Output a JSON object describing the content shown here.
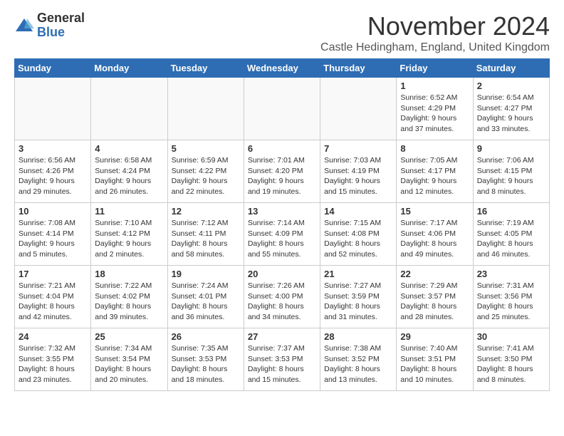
{
  "logo": {
    "general": "General",
    "blue": "Blue"
  },
  "title": "November 2024",
  "location": "Castle Hedingham, England, United Kingdom",
  "headers": [
    "Sunday",
    "Monday",
    "Tuesday",
    "Wednesday",
    "Thursday",
    "Friday",
    "Saturday"
  ],
  "weeks": [
    [
      {
        "day": "",
        "info": ""
      },
      {
        "day": "",
        "info": ""
      },
      {
        "day": "",
        "info": ""
      },
      {
        "day": "",
        "info": ""
      },
      {
        "day": "",
        "info": ""
      },
      {
        "day": "1",
        "info": "Sunrise: 6:52 AM\nSunset: 4:29 PM\nDaylight: 9 hours\nand 37 minutes."
      },
      {
        "day": "2",
        "info": "Sunrise: 6:54 AM\nSunset: 4:27 PM\nDaylight: 9 hours\nand 33 minutes."
      }
    ],
    [
      {
        "day": "3",
        "info": "Sunrise: 6:56 AM\nSunset: 4:26 PM\nDaylight: 9 hours\nand 29 minutes."
      },
      {
        "day": "4",
        "info": "Sunrise: 6:58 AM\nSunset: 4:24 PM\nDaylight: 9 hours\nand 26 minutes."
      },
      {
        "day": "5",
        "info": "Sunrise: 6:59 AM\nSunset: 4:22 PM\nDaylight: 9 hours\nand 22 minutes."
      },
      {
        "day": "6",
        "info": "Sunrise: 7:01 AM\nSunset: 4:20 PM\nDaylight: 9 hours\nand 19 minutes."
      },
      {
        "day": "7",
        "info": "Sunrise: 7:03 AM\nSunset: 4:19 PM\nDaylight: 9 hours\nand 15 minutes."
      },
      {
        "day": "8",
        "info": "Sunrise: 7:05 AM\nSunset: 4:17 PM\nDaylight: 9 hours\nand 12 minutes."
      },
      {
        "day": "9",
        "info": "Sunrise: 7:06 AM\nSunset: 4:15 PM\nDaylight: 9 hours\nand 8 minutes."
      }
    ],
    [
      {
        "day": "10",
        "info": "Sunrise: 7:08 AM\nSunset: 4:14 PM\nDaylight: 9 hours\nand 5 minutes."
      },
      {
        "day": "11",
        "info": "Sunrise: 7:10 AM\nSunset: 4:12 PM\nDaylight: 9 hours\nand 2 minutes."
      },
      {
        "day": "12",
        "info": "Sunrise: 7:12 AM\nSunset: 4:11 PM\nDaylight: 8 hours\nand 58 minutes."
      },
      {
        "day": "13",
        "info": "Sunrise: 7:14 AM\nSunset: 4:09 PM\nDaylight: 8 hours\nand 55 minutes."
      },
      {
        "day": "14",
        "info": "Sunrise: 7:15 AM\nSunset: 4:08 PM\nDaylight: 8 hours\nand 52 minutes."
      },
      {
        "day": "15",
        "info": "Sunrise: 7:17 AM\nSunset: 4:06 PM\nDaylight: 8 hours\nand 49 minutes."
      },
      {
        "day": "16",
        "info": "Sunrise: 7:19 AM\nSunset: 4:05 PM\nDaylight: 8 hours\nand 46 minutes."
      }
    ],
    [
      {
        "day": "17",
        "info": "Sunrise: 7:21 AM\nSunset: 4:04 PM\nDaylight: 8 hours\nand 42 minutes."
      },
      {
        "day": "18",
        "info": "Sunrise: 7:22 AM\nSunset: 4:02 PM\nDaylight: 8 hours\nand 39 minutes."
      },
      {
        "day": "19",
        "info": "Sunrise: 7:24 AM\nSunset: 4:01 PM\nDaylight: 8 hours\nand 36 minutes."
      },
      {
        "day": "20",
        "info": "Sunrise: 7:26 AM\nSunset: 4:00 PM\nDaylight: 8 hours\nand 34 minutes."
      },
      {
        "day": "21",
        "info": "Sunrise: 7:27 AM\nSunset: 3:59 PM\nDaylight: 8 hours\nand 31 minutes."
      },
      {
        "day": "22",
        "info": "Sunrise: 7:29 AM\nSunset: 3:57 PM\nDaylight: 8 hours\nand 28 minutes."
      },
      {
        "day": "23",
        "info": "Sunrise: 7:31 AM\nSunset: 3:56 PM\nDaylight: 8 hours\nand 25 minutes."
      }
    ],
    [
      {
        "day": "24",
        "info": "Sunrise: 7:32 AM\nSunset: 3:55 PM\nDaylight: 8 hours\nand 23 minutes."
      },
      {
        "day": "25",
        "info": "Sunrise: 7:34 AM\nSunset: 3:54 PM\nDaylight: 8 hours\nand 20 minutes."
      },
      {
        "day": "26",
        "info": "Sunrise: 7:35 AM\nSunset: 3:53 PM\nDaylight: 8 hours\nand 18 minutes."
      },
      {
        "day": "27",
        "info": "Sunrise: 7:37 AM\nSunset: 3:53 PM\nDaylight: 8 hours\nand 15 minutes."
      },
      {
        "day": "28",
        "info": "Sunrise: 7:38 AM\nSunset: 3:52 PM\nDaylight: 8 hours\nand 13 minutes."
      },
      {
        "day": "29",
        "info": "Sunrise: 7:40 AM\nSunset: 3:51 PM\nDaylight: 8 hours\nand 10 minutes."
      },
      {
        "day": "30",
        "info": "Sunrise: 7:41 AM\nSunset: 3:50 PM\nDaylight: 8 hours\nand 8 minutes."
      }
    ]
  ]
}
